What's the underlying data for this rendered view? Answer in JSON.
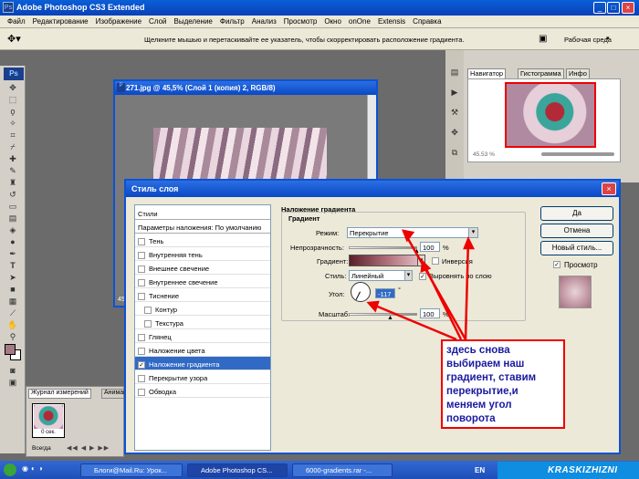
{
  "app": {
    "title": "Adobe Photoshop CS3 Extended"
  },
  "menu": [
    "Файл",
    "Редактирование",
    "Изображение",
    "Слой",
    "Выделение",
    "Фильтр",
    "Анализ",
    "Просмотр",
    "Окно",
    "onOne",
    "Extensis",
    "Справка"
  ],
  "options_bar": {
    "hint": "Щелкните мышью и перетаскивайте ее указатель, чтобы скорректировать расположение градиента.",
    "workspace": "Рабочая среда"
  },
  "document": {
    "title": "271.jpg @ 45,5% (Слой 1 (копия) 2, RGB/8)",
    "zoom_left": "45"
  },
  "panels": {
    "tabs": [
      "Навигатор",
      "Гистограмма",
      "Инфо"
    ],
    "zoom": "45.53 %",
    "bottom_tabs": [
      "Журнал измерений",
      "Анимац"
    ],
    "frame_time": "0 сек.",
    "loop": "Всегда"
  },
  "dialog": {
    "title": "Стиль слоя",
    "styles_header": "Стили",
    "blend_default": "Параметры наложения: По умолчанию",
    "styles": [
      {
        "label": "Тень",
        "checked": false,
        "indent": false,
        "selected": false
      },
      {
        "label": "Внутренняя тень",
        "checked": false,
        "indent": false,
        "selected": false
      },
      {
        "label": "Внешнее свечение",
        "checked": false,
        "indent": false,
        "selected": false
      },
      {
        "label": "Внутреннее свечение",
        "checked": false,
        "indent": false,
        "selected": false
      },
      {
        "label": "Тиснение",
        "checked": false,
        "indent": false,
        "selected": false
      },
      {
        "label": "Контур",
        "checked": false,
        "indent": true,
        "selected": false
      },
      {
        "label": "Текстура",
        "checked": false,
        "indent": true,
        "selected": false
      },
      {
        "label": "Глянец",
        "checked": false,
        "indent": false,
        "selected": false
      },
      {
        "label": "Наложение цвета",
        "checked": false,
        "indent": false,
        "selected": false
      },
      {
        "label": "Наложение градиента",
        "checked": true,
        "indent": false,
        "selected": true
      },
      {
        "label": "Перекрытие узора",
        "checked": false,
        "indent": false,
        "selected": false
      },
      {
        "label": "Обводка",
        "checked": false,
        "indent": false,
        "selected": false
      }
    ],
    "section_title": "Наложение градиента",
    "group_title": "Градиент",
    "mode_label": "Режим:",
    "mode_value": "Перекрытие",
    "opacity_label": "Непрозрачность:",
    "opacity_value": "100",
    "percent": "%",
    "gradient_label": "Градиент:",
    "inverse_label": "Инверсия",
    "style_label": "Стиль:",
    "style_value": "Линейный",
    "align_label": "Выровнять по слою",
    "angle_label": "Угол:",
    "angle_value": "-117",
    "degree": "°",
    "scale_label": "Масштаб:",
    "scale_value": "100",
    "buttons": {
      "ok": "Да",
      "cancel": "Отмена",
      "new_style": "Новый стиль...",
      "preview": "Просмотр"
    }
  },
  "callout": "здесь снова выбираем наш градиент, ставим перекрытие,и меняем угол поворота",
  "taskbar": {
    "items": [
      "Блоги@Mail.Ru: Урок...",
      "Adobe Photoshop CS...",
      "6000-gradients.rar -..."
    ],
    "lang": "EN",
    "watermark": "KRASKIZHIZNI"
  }
}
